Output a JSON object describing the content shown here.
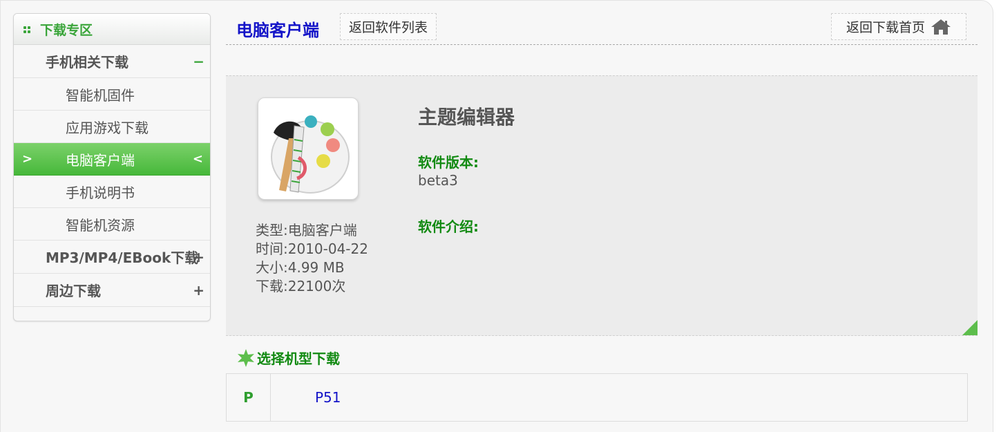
{
  "sidebar": {
    "header": "下载专区",
    "groups": [
      {
        "label": "手机相关下载",
        "toggle": "−",
        "items": [
          "智能机固件",
          "应用游戏下载",
          "电脑客户端",
          "手机说明书",
          "智能机资源"
        ]
      },
      {
        "label": "MP3/MP4/EBook下载",
        "toggle": "+"
      },
      {
        "label": "周边下载",
        "toggle": "+"
      }
    ],
    "active_arrow_left": ">",
    "active_arrow_right": "<"
  },
  "main": {
    "title": "电脑客户端",
    "back_list": "返回软件列表",
    "back_home": "返回下载首页"
  },
  "software": {
    "name": "主题编辑器",
    "type": "类型:电脑客户端",
    "date": "时间:2010-04-22",
    "size": "大小:4.99 MB",
    "downloads": "下载:22100次",
    "version_label": "软件版本:",
    "version_value": "beta3",
    "intro_label": "软件介绍:"
  },
  "download": {
    "title": "选择机型下载",
    "rows": [
      {
        "letter": "P",
        "model": "P51"
      }
    ]
  },
  "colors": {
    "accent_green": "#3aa53a",
    "link_blue": "#1414c8",
    "label_green": "#128a12"
  },
  "icons": [
    "dots-icon",
    "home-icon",
    "star-icon",
    "palette-app-icon"
  ]
}
